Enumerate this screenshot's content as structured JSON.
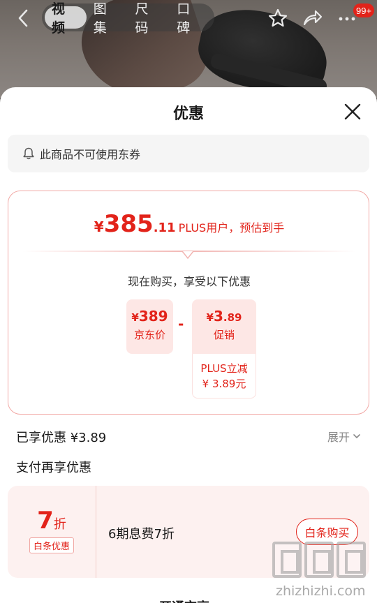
{
  "header": {
    "tabs": [
      {
        "label": "视频",
        "active": true
      },
      {
        "label": "图集",
        "active": false
      },
      {
        "label": "尺码",
        "active": false
      },
      {
        "label": "口碑",
        "active": false
      }
    ],
    "icons": [
      "chevron-left-icon",
      "star-icon",
      "share-icon",
      "more-icon"
    ],
    "notification_badge": "99+"
  },
  "sheet": {
    "title": "优惠",
    "notice": "此商品不可使用东券",
    "estimate": {
      "currency": "¥",
      "integer": "385",
      "decimal": ".11",
      "suffix": "PLUS用户，预估到手"
    },
    "buy_now_text": "现在购买，享受以下优惠",
    "jd_price": {
      "currency": "¥",
      "value": "389",
      "label": "京东价"
    },
    "minus_sign": "-",
    "promo": {
      "currency": "¥",
      "integer": "3",
      "decimal": ".89",
      "label": "促销",
      "detail_line1": "PLUS立减",
      "detail_line2": "¥ 3.89元"
    },
    "enjoyed": "已享优惠 ¥3.89",
    "expand": "展开",
    "pay_more_title": "支付再享优惠",
    "offer": {
      "discount": "7",
      "discount_unit": "折",
      "tag": "白条优惠",
      "description": "6期息费7折",
      "button": "白条购买"
    },
    "bottom_partial": "开通京享"
  },
  "watermark": {
    "text": "zhizhizhi.com"
  },
  "colors": {
    "accent": "#e2231a",
    "accent_light": "#fde7e5",
    "card_border": "#f2a9a6"
  }
}
